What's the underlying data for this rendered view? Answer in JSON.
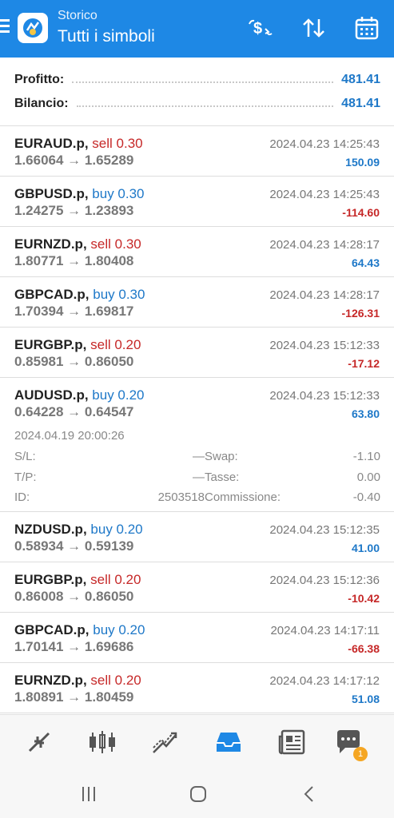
{
  "header": {
    "subtitle": "Storico",
    "title": "Tutti i simboli"
  },
  "summary": {
    "profit_label": "Profitto:",
    "profit_value": "481.41",
    "balance_label": "Bilancio:",
    "balance_value": "481.41"
  },
  "deals": [
    {
      "symbol": "EURAUD.p,",
      "side": "sell 0.30",
      "prices": "1.66064 → 1.65289",
      "time": "2024.04.23 14:25:43",
      "profit": "150.09"
    },
    {
      "symbol": "GBPUSD.p,",
      "side": "buy 0.30",
      "prices": "1.24275 → 1.23893",
      "time": "2024.04.23 14:25:43",
      "profit": "-114.60"
    },
    {
      "symbol": "EURNZD.p,",
      "side": "sell 0.30",
      "prices": "1.80771 → 1.80408",
      "time": "2024.04.23 14:28:17",
      "profit": "64.43"
    },
    {
      "symbol": "GBPCAD.p,",
      "side": "buy 0.30",
      "prices": "1.70394 → 1.69817",
      "time": "2024.04.23 14:28:17",
      "profit": "-126.31"
    },
    {
      "symbol": "EURGBP.p,",
      "side": "sell 0.20",
      "prices": "0.85981 → 0.86050",
      "time": "2024.04.23 15:12:33",
      "profit": "-17.12"
    },
    {
      "symbol": "AUDUSD.p,",
      "side": "buy 0.20",
      "prices": "0.64228 → 0.64547",
      "time": "2024.04.23 15:12:33",
      "profit": "63.80"
    },
    {
      "symbol": "NZDUSD.p,",
      "side": "buy 0.20",
      "prices": "0.58934 → 0.59139",
      "time": "2024.04.23 15:12:35",
      "profit": "41.00"
    },
    {
      "symbol": "EURGBP.p,",
      "side": "sell 0.20",
      "prices": "0.86008 → 0.86050",
      "time": "2024.04.23 15:12:36",
      "profit": "-10.42"
    },
    {
      "symbol": "GBPCAD.p,",
      "side": "buy 0.20",
      "prices": "1.70141 → 1.69686",
      "time": "2024.04.23 14:17:11",
      "profit": "-66.38"
    },
    {
      "symbol": "EURNZD.p,",
      "side": "sell 0.20",
      "prices": "1.80891 → 1.80459",
      "time": "2024.04.23 14:17:12",
      "profit": "51.08"
    }
  ],
  "expanded": {
    "open_time": "2024.04.19 20:00:26",
    "sl_label": "S/L:",
    "sl_value": "—",
    "tp_label": "T/P:",
    "tp_value": "—",
    "id_label": "ID:",
    "id_value": "2503518",
    "swap_label": "Swap:",
    "swap_value": "-1.10",
    "tax_label": "Tasse:",
    "tax_value": "0.00",
    "commission_label": "Commissione:",
    "commission_value": "-0.40"
  },
  "tabs": {
    "chat_badge": "1"
  },
  "colors": {
    "header_bg": "#1e88e5",
    "buy": "#1e78c8",
    "sell": "#c62828",
    "active_tab": "#1e88e5"
  },
  "icons": [
    "menu-icon",
    "app-logo-icon",
    "dollar-swap-icon",
    "sort-icon",
    "calendar-icon",
    "quotes-icon",
    "chart-icon",
    "trade-icon",
    "history-icon",
    "news-icon",
    "chat-icon",
    "recent-apps-icon",
    "home-icon",
    "back-icon"
  ]
}
